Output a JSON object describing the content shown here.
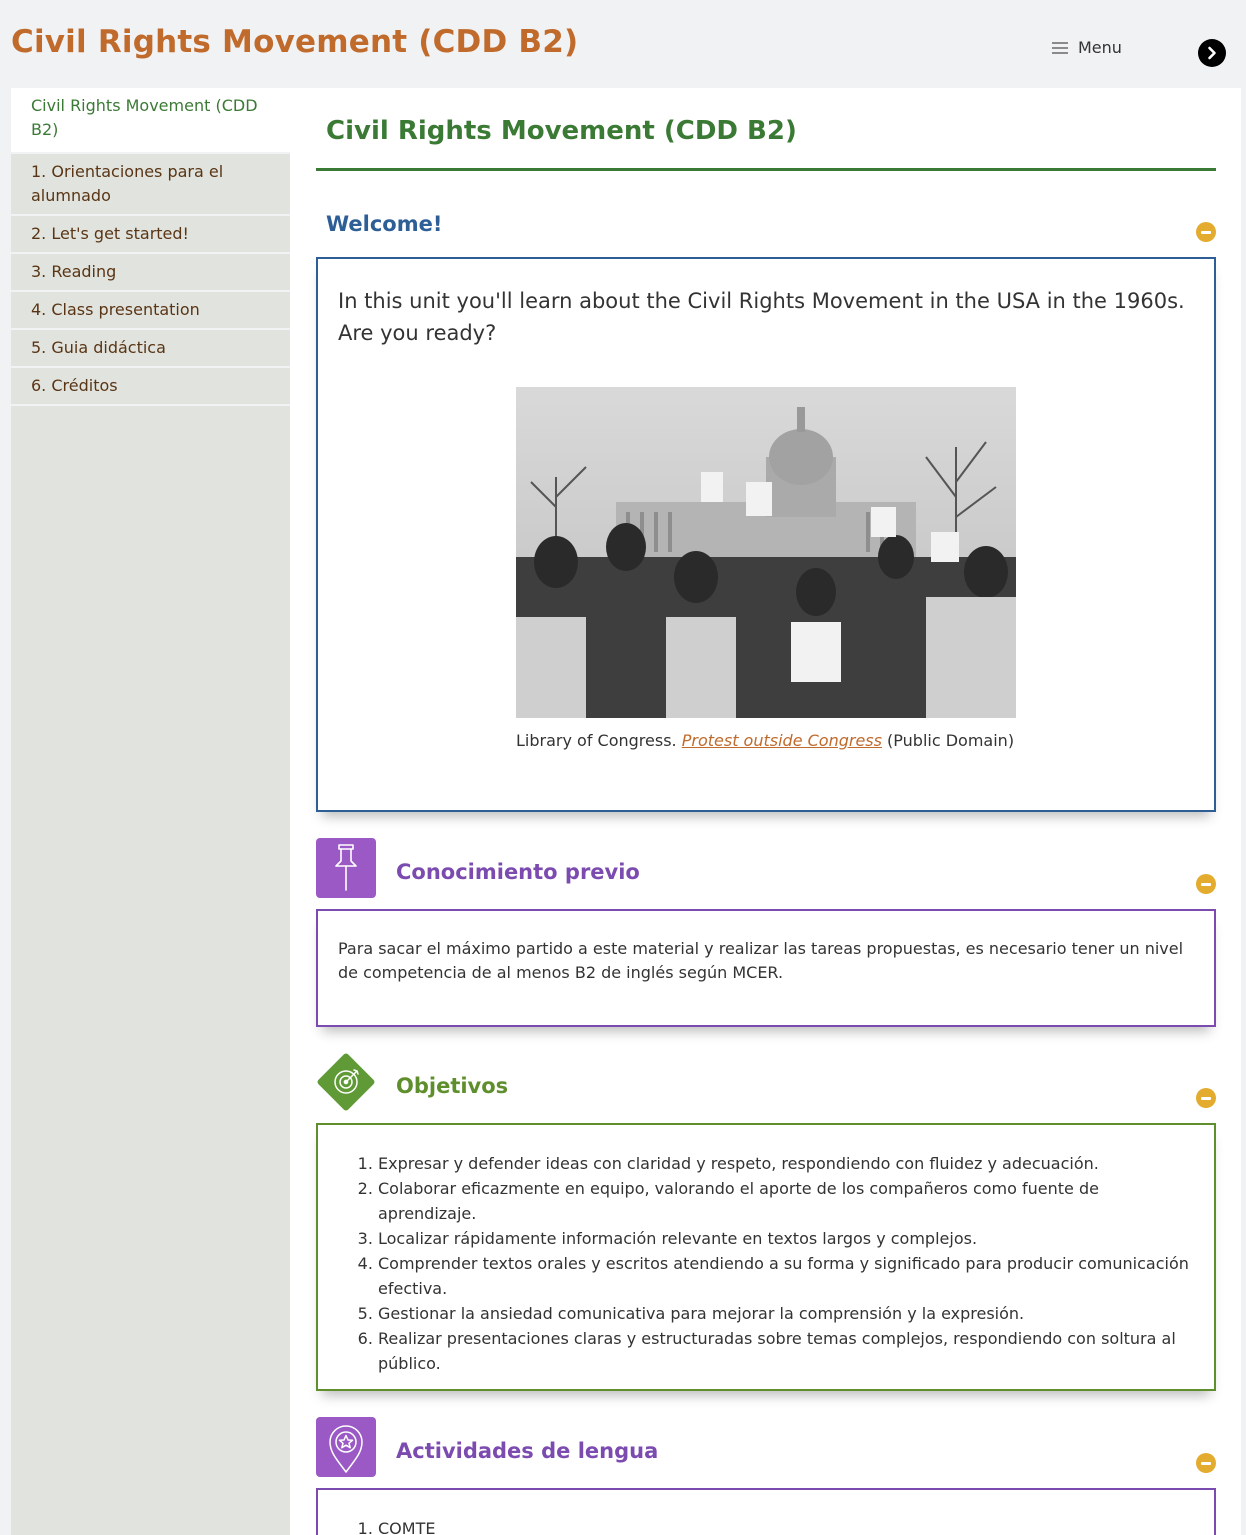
{
  "header": {
    "site_title": "Civil Rights Movement (CDD B2)",
    "menu_label": "Menu"
  },
  "sidebar": {
    "items": [
      {
        "label": "Civil Rights Movement (CDD B2)",
        "active": true
      },
      {
        "label": "1. Orientaciones para el alumnado"
      },
      {
        "label": "2. Let's get started!"
      },
      {
        "label": "3. Reading"
      },
      {
        "label": "4. Class presentation"
      },
      {
        "label": "5. Guia didáctica"
      },
      {
        "label": "6. Créditos"
      }
    ]
  },
  "main": {
    "title": "Civil Rights Movement (CDD B2)",
    "welcome": {
      "heading": "Welcome!",
      "intro": "In this unit you'll learn about the Civil Rights Movement in the USA in the 1960s. Are you ready?",
      "caption_prefix": "Library of Congress. ",
      "caption_link": "Protest outside Congress",
      "caption_suffix": " (Public Domain)"
    },
    "conocimiento": {
      "heading": "Conocimiento previo",
      "text": "Para sacar el máximo partido a este material y realizar las tareas propuestas, es necesario tener un nivel de competencia de al menos B2 de inglés según MCER."
    },
    "objetivos": {
      "heading": "Objetivos",
      "items": [
        "Expresar y defender ideas con claridad y respeto, respondiendo con fluidez y adecuación.",
        "Colaborar eficazmente en equipo, valorando el aporte de los compañeros como fuente de aprendizaje.",
        "Localizar rápidamente información relevante en textos largos y complejos.",
        "Comprender textos orales y escritos atendiendo a su forma y significado para producir comunicación efectiva.",
        "Gestionar la ansiedad comunicativa para mejorar la comprensión y la expresión.",
        "Realizar presentaciones claras y estructuradas sobre temas complejos, respondiendo con soltura al público."
      ]
    },
    "actividades": {
      "heading": "Actividades de lengua",
      "items": [
        "COMTE"
      ]
    }
  },
  "colors": {
    "site_title": "#c06a2c",
    "green": "#3b7a35",
    "blue": "#2d5f96",
    "purple": "#7b4bb0",
    "olive": "#5f8f2d",
    "toggle": "#e3ac2f"
  }
}
